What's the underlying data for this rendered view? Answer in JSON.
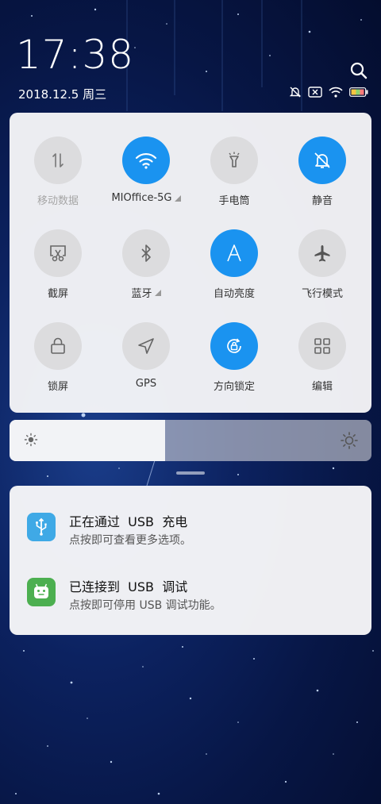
{
  "status_bar": {
    "time": "17:38",
    "date": "2018.12.5 周三",
    "icons": [
      "mute-bell-icon",
      "no-sim-icon",
      "wifi-icon",
      "battery-icon"
    ]
  },
  "quick_settings": {
    "tiles": [
      {
        "label": "移动数据",
        "icon": "mobile-data-icon",
        "active": false,
        "disabled": true
      },
      {
        "label": "MIOffice-5G",
        "icon": "wifi-icon",
        "active": true,
        "expandable": true
      },
      {
        "label": "手电筒",
        "icon": "flashlight-icon",
        "active": false
      },
      {
        "label": "静音",
        "icon": "mute-bell-icon",
        "active": true
      },
      {
        "label": "截屏",
        "icon": "screenshot-icon",
        "active": false
      },
      {
        "label": "蓝牙",
        "icon": "bluetooth-icon",
        "active": false,
        "expandable": true
      },
      {
        "label": "自动亮度",
        "icon": "auto-brightness-icon",
        "active": true
      },
      {
        "label": "飞行模式",
        "icon": "airplane-icon",
        "active": false
      },
      {
        "label": "锁屏",
        "icon": "lock-icon",
        "active": false
      },
      {
        "label": "GPS",
        "icon": "location-arrow-icon",
        "active": false
      },
      {
        "label": "方向锁定",
        "icon": "rotation-lock-icon",
        "active": true
      },
      {
        "label": "编辑",
        "icon": "grid-edit-icon",
        "active": false
      }
    ]
  },
  "brightness": {
    "level": 0.43,
    "low_icon": "sun-small-icon",
    "high_icon": "sun-large-icon"
  },
  "notifications": [
    {
      "title": "正在通过  USB  充电",
      "text": "点按即可查看更多选项。",
      "icon": "usb-icon",
      "icon_color": "#3fa9e6"
    },
    {
      "title": "已连接到  USB  调试",
      "text": "点按即可停用 USB 调试功能。",
      "icon": "android-icon",
      "icon_color": "#4caf50"
    }
  ],
  "colors": {
    "accent": "#1a93f0",
    "tile_off": "#dcdcde",
    "panel": "#f6f6f8"
  }
}
